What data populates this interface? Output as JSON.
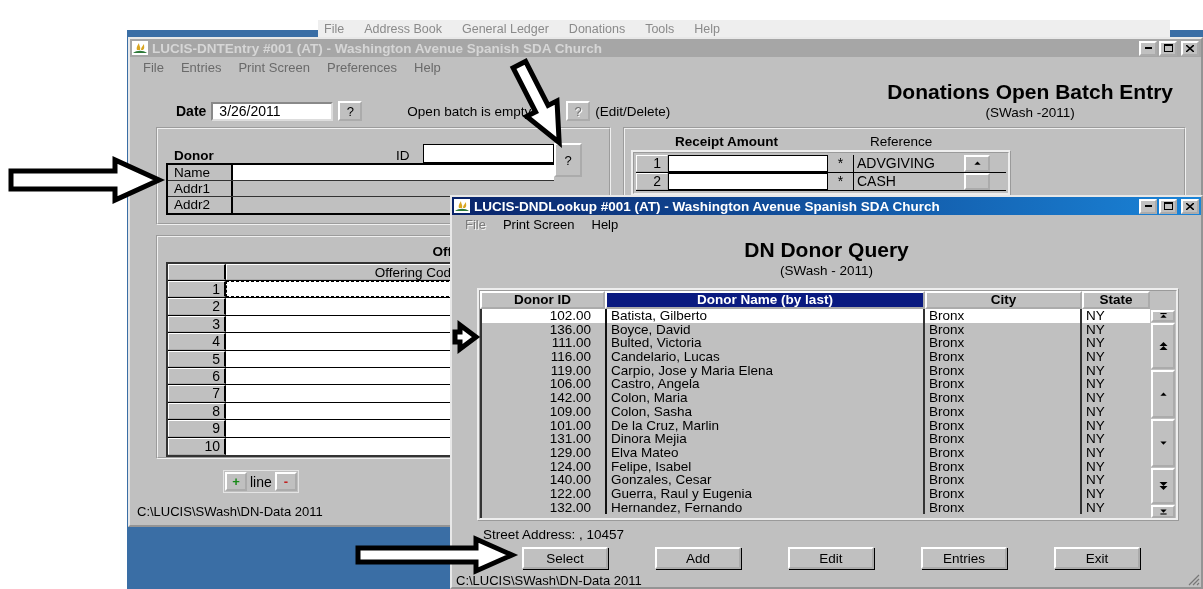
{
  "app_menu": [
    "File",
    "Address Book",
    "General Ledger",
    "Donations",
    "Tools",
    "Help"
  ],
  "entry_window": {
    "title": "LUCIS-DNTEntry #001 (AT) - Washington Avenue Spanish SDA Church",
    "active": false,
    "menu": [
      "File",
      "Entries",
      "Print Screen",
      "Preferences",
      "Help"
    ],
    "date_label": "Date",
    "date": "3/26/2011",
    "date_button": "?",
    "batch_label": "Open batch is empty",
    "batch_button": {
      "label": "?",
      "disabled": true
    },
    "batch_note": "(Edit/Delete)",
    "heading": "Donations Open Batch Entry",
    "subheading": "(SWash -2011)",
    "donor": {
      "title": "Donor",
      "id_label": "ID",
      "id_button": "?",
      "fields": [
        "Name",
        "Addr1",
        "Addr2"
      ]
    },
    "receipt": {
      "columns": [
        "Receipt Amount",
        "Reference"
      ],
      "rows": [
        {
          "number": "1",
          "flag": "*",
          "reference": "ADVGIVING"
        },
        {
          "number": "2",
          "flag": "*",
          "reference": "CASH"
        }
      ]
    },
    "offerings": {
      "title": "Off",
      "column": "Offering Cod",
      "rows": [
        {
          "number": "1",
          "focused": true
        },
        {
          "number": "2",
          "focused": false
        },
        {
          "number": "3",
          "focused": false
        },
        {
          "number": "4",
          "focused": false
        },
        {
          "number": "5",
          "focused": false
        },
        {
          "number": "6",
          "focused": false
        },
        {
          "number": "7",
          "focused": false
        },
        {
          "number": "8",
          "focused": false
        },
        {
          "number": "9",
          "focused": false
        },
        {
          "number": "10",
          "focused": false
        }
      ]
    },
    "line_buttons": [
      "+",
      "line",
      "-"
    ],
    "status": "C:\\LUCIS\\SWash\\DN-Data 2011"
  },
  "lookup_window": {
    "title": "LUCIS-DNDLookup #001 (AT) - Washington Avenue Spanish SDA Church",
    "active": true,
    "menu": [
      {
        "label": "File",
        "disabled": true
      },
      {
        "label": "Print Screen",
        "disabled": false
      },
      {
        "label": "Help",
        "disabled": false
      }
    ],
    "heading": "DN Donor Query",
    "subheading": "(SWash - 2011)",
    "columns": [
      {
        "label": "Donor ID",
        "selected": false
      },
      {
        "label": "Donor Name (by last)",
        "selected": true
      },
      {
        "label": "City",
        "selected": false
      },
      {
        "label": "State",
        "selected": false
      }
    ],
    "rows": [
      {
        "id": "102.00",
        "name": "Batista, Gilberto",
        "city": "Bronx",
        "state": "NY",
        "selected": true
      },
      {
        "id": "136.00",
        "name": "Boyce, David",
        "city": "Bronx",
        "state": "NY",
        "selected": false
      },
      {
        "id": "111.00",
        "name": "Bulted, Victoria",
        "city": "Bronx",
        "state": "NY",
        "selected": false
      },
      {
        "id": "116.00",
        "name": "Candelario, Lucas",
        "city": "Bronx",
        "state": "NY",
        "selected": false
      },
      {
        "id": "119.00",
        "name": "Carpio, Jose y Maria Elena",
        "city": "Bronx",
        "state": "NY",
        "selected": false
      },
      {
        "id": "106.00",
        "name": "Castro, Angela",
        "city": "Bronx",
        "state": "NY",
        "selected": false
      },
      {
        "id": "142.00",
        "name": "Colon, Maria",
        "city": "Bronx",
        "state": "NY",
        "selected": false
      },
      {
        "id": "109.00",
        "name": "Colon, Sasha",
        "city": "Bronx",
        "state": "NY",
        "selected": false
      },
      {
        "id": "101.00",
        "name": "De la Cruz, Marlin",
        "city": "Bronx",
        "state": "NY",
        "selected": false
      },
      {
        "id": "131.00",
        "name": "Dinora Mejia",
        "city": "Bronx",
        "state": "NY",
        "selected": false
      },
      {
        "id": "129.00",
        "name": "Elva Mateo",
        "city": "Bronx",
        "state": "NY",
        "selected": false
      },
      {
        "id": "124.00",
        "name": "Felipe, Isabel",
        "city": "Bronx",
        "state": "NY",
        "selected": false
      },
      {
        "id": "140.00",
        "name": "Gonzales, Cesar",
        "city": "Bronx",
        "state": "NY",
        "selected": false
      },
      {
        "id": "122.00",
        "name": "Guerra, Raul y Eugenia",
        "city": "Bronx",
        "state": "NY",
        "selected": false
      },
      {
        "id": "132.00",
        "name": "Hernandez, Fernando",
        "city": "Bronx",
        "state": "NY",
        "selected": false
      }
    ],
    "street_address": "Street Address: , 10457",
    "buttons": [
      "Select",
      "Add",
      "Edit",
      "Entries",
      "Exit"
    ],
    "status": "C:\\LUCIS\\SWash\\DN-Data 2011"
  }
}
